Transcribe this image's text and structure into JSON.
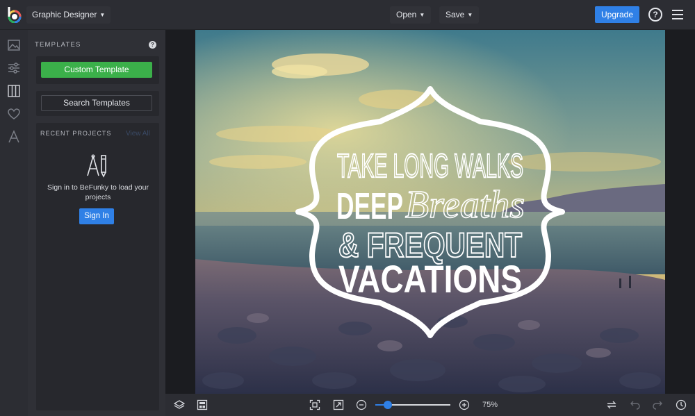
{
  "app": {
    "mode_label": "Graphic Designer",
    "logo_letter": "b"
  },
  "header": {
    "open_label": "Open",
    "save_label": "Save",
    "upgrade_label": "Upgrade",
    "help_glyph": "?"
  },
  "rail": {
    "icons": [
      "image-icon",
      "sliders-icon",
      "columns-icon",
      "heart-icon",
      "text-icon"
    ]
  },
  "panel": {
    "templates_heading": "TEMPLATES",
    "help_glyph": "?",
    "custom_template_label": "Custom Template",
    "search_templates_label": "Search Templates",
    "recent_heading": "RECENT PROJECTS",
    "view_all_label": "View All",
    "recent_message": "Sign in to BeFunky to load your projects",
    "signin_label": "Sign In"
  },
  "canvas": {
    "line1": "TAKE LONG WALKS",
    "line2a": "DEEP",
    "line2b": "Breaths",
    "line3": "& FREQUENT",
    "line4": "VACATIONS"
  },
  "bottombar": {
    "zoom_percent": 75,
    "zoom_fraction": 0.17,
    "zoom_label": "75%",
    "minus_glyph": "−",
    "plus_glyph": "+"
  },
  "colors": {
    "accent_blue": "#2f80e6",
    "accent_green": "#3bb04a"
  }
}
